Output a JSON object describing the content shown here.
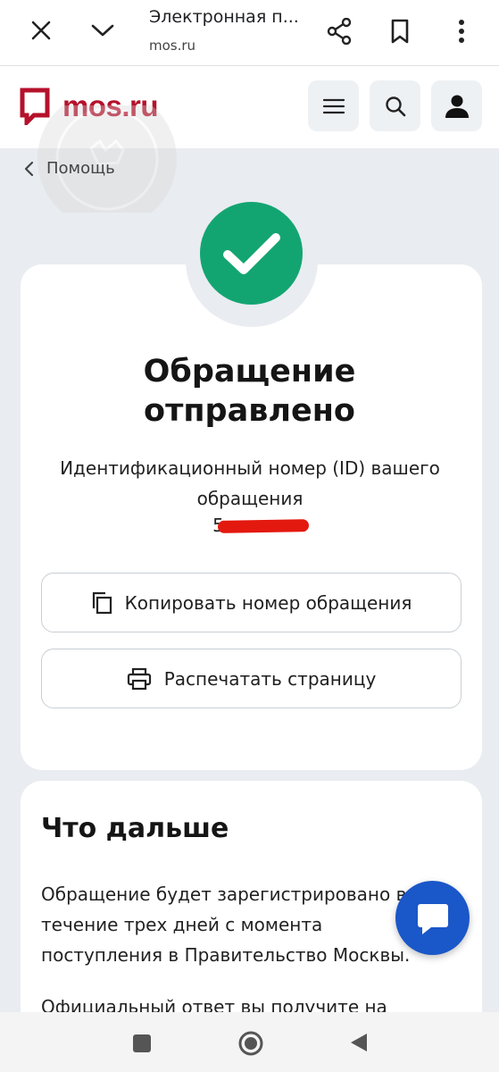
{
  "browser": {
    "title": "Электронная п...",
    "url": "mos.ru",
    "icons": [
      "close-icon",
      "chevron-down-icon",
      "share-icon",
      "bookmark-icon",
      "more-vert-icon"
    ]
  },
  "site": {
    "logo_text": "mos.ru",
    "brand_color": "#b5112b",
    "header_buttons": [
      "menu-icon",
      "search-icon",
      "user-icon"
    ]
  },
  "breadcrumb": {
    "label": "Помощь"
  },
  "result": {
    "status_color": "#13a571",
    "title_line1": "Обращение",
    "title_line2": "отправлено",
    "description": "Идентификационный номер (ID) вашего обращения",
    "id_visible_prefix": "5"
  },
  "actions": {
    "copy_label": "Копировать номер обращения",
    "print_label": "Распечатать страницу"
  },
  "next": {
    "title": "Что дальше",
    "paragraph1": "Обращение будет зарегистрировано в течение трех дней с момента поступления в Правительство Москвы.",
    "paragraph2": "Официальный ответ вы получите на"
  },
  "chat": {
    "icon": "chat-icon",
    "color": "#1a57c8"
  },
  "system_nav": [
    "recents-icon",
    "home-icon",
    "back-icon"
  ]
}
